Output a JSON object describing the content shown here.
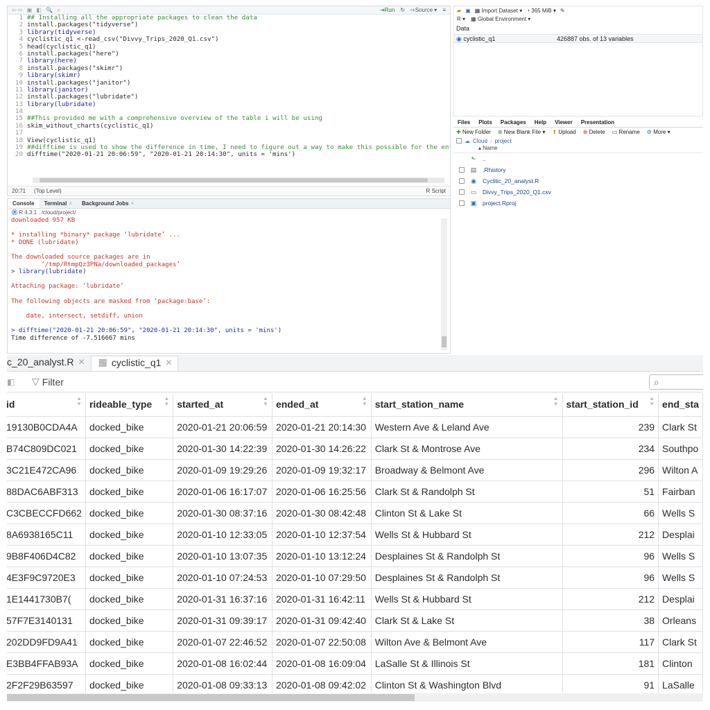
{
  "editor": {
    "toolbar": {
      "run_label": "Run",
      "source_label": "Source"
    },
    "lines": [
      {
        "n": "1",
        "text": "## Installing all the appropriate packages to clean the data",
        "kind": "comment"
      },
      {
        "n": "2",
        "text": "install.packages(\"tidyverse\")",
        "kind": "plain"
      },
      {
        "n": "3",
        "text": "library(tidyverse)",
        "kind": "code"
      },
      {
        "n": "4",
        "text": "cyclistic_q1 <-read_csv(\"Divvy_Trips_2020_Q1.csv\")",
        "kind": "plain"
      },
      {
        "n": "5",
        "text": "head(cyclistic_q1)",
        "kind": "plain"
      },
      {
        "n": "6",
        "text": "install.packages(\"here\")",
        "kind": "plain"
      },
      {
        "n": "7",
        "text": "library(here)",
        "kind": "code"
      },
      {
        "n": "8",
        "text": "install.packages(\"skimr\")",
        "kind": "plain"
      },
      {
        "n": "9",
        "text": "library(skimr)",
        "kind": "code"
      },
      {
        "n": "10",
        "text": "install.packages(\"janitor\")",
        "kind": "plain"
      },
      {
        "n": "11",
        "text": "library(janitor)",
        "kind": "code"
      },
      {
        "n": "12",
        "text": "install.packages(\"lubridate\")",
        "kind": "plain"
      },
      {
        "n": "13",
        "text": "library(lubridate)",
        "kind": "code"
      },
      {
        "n": "14",
        "text": "",
        "kind": "plain"
      },
      {
        "n": "15",
        "text": "##This provided me with a comprehensive overview of the table i will be using",
        "kind": "comment"
      },
      {
        "n": "16",
        "text": "skim_without_charts(cyclistic_q1)",
        "kind": "plain"
      },
      {
        "n": "17",
        "text": "",
        "kind": "plain"
      },
      {
        "n": "18",
        "text": "View(cyclistic_q1)",
        "kind": "plain"
      },
      {
        "n": "19",
        "text": "##difftime is used to show the difference in time, I need to figure out a way to make this possible for the entir",
        "kind": "comment"
      },
      {
        "n": "20",
        "text": "difftime(\"2020-01-21 20:06:59\", \"2020-01-21 20:14:30\", units = 'mins')",
        "kind": "plain"
      }
    ],
    "status": {
      "position": "20:71",
      "scope": "(Top Level)",
      "filetype": "R Script"
    }
  },
  "console": {
    "tabs": [
      "Console",
      "Terminal",
      "Background Jobs"
    ],
    "path": "R 4.3.1 . /cloud/project/",
    "lines": [
      {
        "text": "downloaded 957 KB",
        "kind": "red"
      },
      {
        "text": "",
        "kind": "black"
      },
      {
        "text": "* installing *binary* package ‘lubridate’ ...",
        "kind": "red"
      },
      {
        "text": "* DONE (lubridate)",
        "kind": "red"
      },
      {
        "text": "",
        "kind": "black"
      },
      {
        "text": "The downloaded source packages are in",
        "kind": "red"
      },
      {
        "text": "        ‘/tmp/RtmpQz3PNa/downloaded_packages’",
        "kind": "red"
      },
      {
        "text": "> library(lubridate)",
        "kind": "blue"
      },
      {
        "text": "",
        "kind": "black"
      },
      {
        "text": "Attaching package: ‘lubridate’",
        "kind": "red"
      },
      {
        "text": "",
        "kind": "black"
      },
      {
        "text": "The following objects are masked from ‘package:base’:",
        "kind": "red"
      },
      {
        "text": "",
        "kind": "black"
      },
      {
        "text": "    date, intersect, setdiff, union",
        "kind": "red"
      },
      {
        "text": "",
        "kind": "black"
      },
      {
        "text": "> difftime(\"2020-01-21 20:06:59\", \"2020-01-21 20:14:30\", units = 'mins')",
        "kind": "blue"
      },
      {
        "text": "Time difference of -7.516667 mins",
        "kind": "black"
      }
    ]
  },
  "environment": {
    "toolbar": {
      "import_label": "Import Dataset",
      "memory": "365 MiB"
    },
    "lang": "R",
    "scope": "Global Environment",
    "section": "Data",
    "row": {
      "name": "cyclistic_q1",
      "value": "426887 obs. of 13 variables"
    }
  },
  "files": {
    "tabs": [
      "Files",
      "Plots",
      "Packages",
      "Help",
      "Viewer",
      "Presentation"
    ],
    "toolbar": [
      "New Folder",
      "New Blank File",
      "Upload",
      "Delete",
      "Rename",
      "More"
    ],
    "crumbs": [
      "Cloud",
      "project"
    ],
    "header": "Name",
    "items": [
      "..",
      ".Rhistory",
      "Cyclitic_20_analyst.R",
      "Divvy_Trips_2020_Q1.csv",
      "project.Rproj"
    ]
  },
  "viewer": {
    "tabs": [
      {
        "label": "c_20_analyst.R"
      },
      {
        "label": "cyclistic_q1"
      }
    ],
    "filter_label": "Filter",
    "columns": [
      "id",
      "rideable_type",
      "started_at",
      "ended_at",
      "start_station_name",
      "start_station_id",
      "end_sta"
    ],
    "rows": [
      [
        "19130B0CDA4A",
        "docked_bike",
        "2020-01-21 20:06:59",
        "2020-01-21 20:14:30",
        "Western Ave & Leland Ave",
        "239",
        "Clark St"
      ],
      [
        "B74C809DC021",
        "docked_bike",
        "2020-01-30 14:22:39",
        "2020-01-30 14:26:22",
        "Clark St & Montrose Ave",
        "234",
        "Southpo"
      ],
      [
        "3C21E472CA96",
        "docked_bike",
        "2020-01-09 19:29:26",
        "2020-01-09 19:32:17",
        "Broadway & Belmont Ave",
        "296",
        "Wilton A"
      ],
      [
        "88DAC6ABF313",
        "docked_bike",
        "2020-01-06 16:17:07",
        "2020-01-06 16:25:56",
        "Clark St & Randolph St",
        "51",
        "Fairban"
      ],
      [
        "C3CBECCFD662",
        "docked_bike",
        "2020-01-30 08:37:16",
        "2020-01-30 08:42:48",
        "Clinton St & Lake St",
        "66",
        "Wells S"
      ],
      [
        "8A6938165C11",
        "docked_bike",
        "2020-01-10 12:33:05",
        "2020-01-10 12:37:54",
        "Wells St & Hubbard St",
        "212",
        "Desplai"
      ],
      [
        "9B8F406D4C82",
        "docked_bike",
        "2020-01-10 13:07:35",
        "2020-01-10 13:12:24",
        "Desplaines St & Randolph St",
        "96",
        "Wells S"
      ],
      [
        "4E3F9C9720E3",
        "docked_bike",
        "2020-01-10 07:24:53",
        "2020-01-10 07:29:50",
        "Desplaines St & Randolph St",
        "96",
        "Wells S"
      ],
      [
        ")1E1441730B7",
        "docked_bike",
        "2020-01-31 16:37:16",
        "2020-01-31 16:42:11",
        "Wells St & Hubbard St",
        "212",
        "Desplai"
      ],
      [
        "57F7E3140131",
        "docked_bike",
        "2020-01-31 09:39:17",
        "2020-01-31 09:42:40",
        "Clark St & Lake St",
        "38",
        "Orleans"
      ],
      [
        "202DD9FD9A41",
        "docked_bike",
        "2020-01-07 22:46:52",
        "2020-01-07 22:50:08",
        "Wilton Ave & Belmont Ave",
        "117",
        "Clark St"
      ],
      [
        "E3BB4FFAB93A",
        "docked_bike",
        "2020-01-08 16:02:44",
        "2020-01-08 16:09:04",
        "LaSalle St & Illinois St",
        "181",
        "Clinton"
      ],
      [
        "2F2F29B63597",
        "docked_bike",
        "2020-01-08 09:33:13",
        "2020-01-08 09:42:02",
        "Clinton St & Washington Blvd",
        "91",
        "LaSalle"
      ]
    ]
  }
}
